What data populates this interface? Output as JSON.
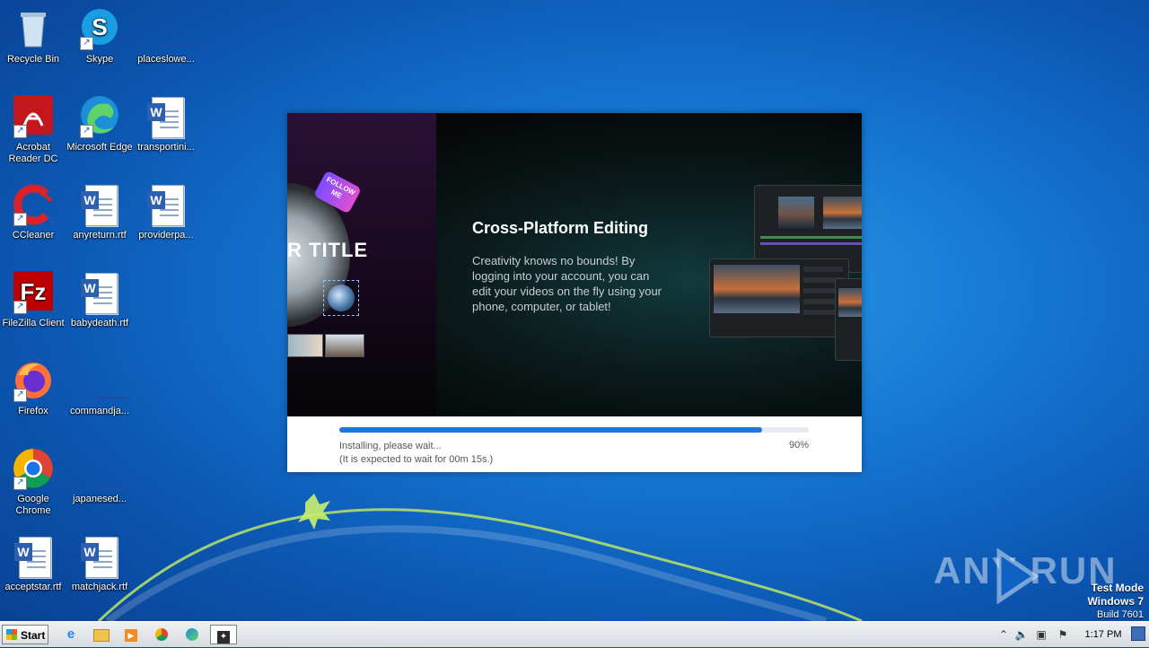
{
  "desktop": {
    "icons": [
      {
        "label": "Recycle Bin"
      },
      {
        "label": "Skype"
      },
      {
        "label": "placeslowe..."
      },
      {
        "label": "Acrobat Reader DC"
      },
      {
        "label": "Microsoft Edge"
      },
      {
        "label": "transportini..."
      },
      {
        "label": "CCleaner"
      },
      {
        "label": "anyreturn.rtf"
      },
      {
        "label": "providerpa..."
      },
      {
        "label": "FileZilla Client"
      },
      {
        "label": "babydeath.rtf"
      },
      {
        "label": "Firefox"
      },
      {
        "label": "commandja..."
      },
      {
        "label": "Google Chrome"
      },
      {
        "label": "japanesed..."
      },
      {
        "label": "acceptstar.rtf"
      },
      {
        "label": "matchjack.rtf"
      }
    ]
  },
  "installer": {
    "banner": {
      "title": "Cross-Platform Editing",
      "description": "Creativity knows no bounds! By logging into your account, you can edit your videos on the fly using your phone, computer, or tablet!",
      "badge_text": "FOLLOW ME",
      "title_fragment": "R TITLE"
    },
    "progress": {
      "status_line1": "Installing, please wait...",
      "status_line2": "(It is expected to wait for 00m 15s.)",
      "percent_label": "90%",
      "fraction": 0.9
    }
  },
  "watermark": {
    "text": "ANY RUN",
    "test_mode": "Test Mode",
    "os": "Windows 7",
    "build": "Build 7601"
  },
  "taskbar": {
    "start_label": "Start",
    "clock": "1:17 PM",
    "colors": {
      "progress": "#1f76e0"
    }
  }
}
